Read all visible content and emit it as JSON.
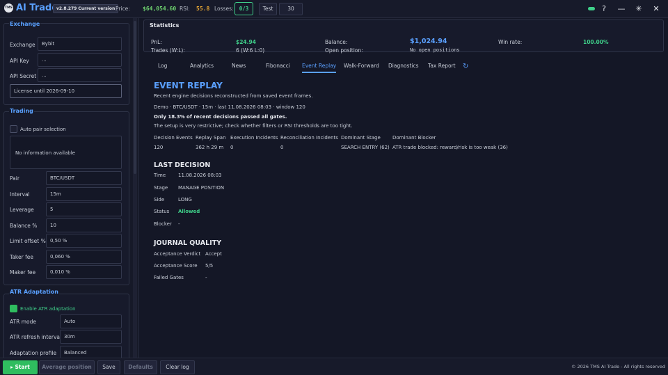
{
  "titlebar": {
    "logo_text": "TMS",
    "app_title": "AI Trade",
    "version": "v2.8.279 Current version",
    "price_label": "Price:",
    "price_value": "$64,054.60",
    "rsi_label": "RSI:",
    "rsi_value": "55.8",
    "losses_label": "Losses:",
    "losses_value": "0/3",
    "test_button": "Test",
    "test_value": "30",
    "help_icon": "?",
    "minimize_icon": "—",
    "maximize_icon": "✳",
    "close_icon": "✕"
  },
  "sidebar": {
    "exchange": {
      "title": "Exchange",
      "exchange_label": "Exchange",
      "exchange_value": "Bybit",
      "api_key_label": "API Key",
      "api_key_value": "...",
      "api_secret_label": "API Secret",
      "api_secret_value": "...",
      "license": "License until 2026-09-10"
    },
    "trading": {
      "title": "Trading",
      "auto_pair_label": "Auto pair selection",
      "info_text": "No information available",
      "fields": [
        {
          "label": "Pair",
          "value": "BTC/USDT"
        },
        {
          "label": "Interval",
          "value": "15m"
        },
        {
          "label": "Leverage",
          "value": "5"
        },
        {
          "label": "Balance %",
          "value": "10"
        },
        {
          "label": "Limit offset %",
          "value": "0,50 %"
        },
        {
          "label": "Taker fee",
          "value": "0,060 %"
        },
        {
          "label": "Maker fee",
          "value": "0,010 %"
        }
      ]
    },
    "atr": {
      "title": "ATR Adaptation",
      "enable_label": "Enable ATR adaptation",
      "fields": [
        {
          "label": "ATR mode",
          "value": "Auto"
        },
        {
          "label": "ATR refresh interval",
          "value": "30m"
        },
        {
          "label": "Adaptation profile",
          "value": "Balanced"
        }
      ]
    }
  },
  "statistics": {
    "title": "Statistics",
    "pnl_label": "PnL:",
    "pnl_value": "$24.94",
    "trades_label": "Trades (W:L):",
    "trades_value": "6 (W:6 L:0)",
    "balance_label": "Balance:",
    "balance_value": "$1,024.94",
    "open_position_label": "Open position:",
    "open_position_value": "No open positions",
    "winrate_label": "Win rate:",
    "winrate_value": "100.00%"
  },
  "tabs": [
    "Log",
    "Analytics",
    "News",
    "Fibonacci",
    "Event Replay",
    "Walk-Forward",
    "Diagnostics",
    "Tax Report"
  ],
  "active_tab": "Event Replay",
  "replay": {
    "heading": "EVENT REPLAY",
    "subtitle": "Recent engine decisions reconstructed from saved event frames.",
    "context": "Demo · BTC/USDT · 15m · last 11.08.2026 08:03 · window 120",
    "gates_line": "Only 18.3% of recent decisions passed all gates.",
    "hint": "The setup is very restrictive; check whether filters or RSI thresholds are too tight.",
    "table_headers": [
      "Decision Events",
      "Replay Span",
      "Execution Incidents",
      "Reconciliation Incidents",
      "Dominant Stage",
      "Dominant Blocker"
    ],
    "table_values": [
      "120",
      "362 h 29 m",
      "0",
      "0",
      "SEARCH ENTRY (62)",
      "ATR trade blocked: reward/risk is too weak (36)"
    ],
    "last_decision_heading": "LAST DECISION",
    "last_decision": [
      {
        "label": "Time",
        "value": "11.08.2026 08:03"
      },
      {
        "label": "Stage",
        "value": "MANAGE POSITION"
      },
      {
        "label": "Side",
        "value": "LONG"
      },
      {
        "label": "Status",
        "value": "Allowed"
      },
      {
        "label": "Blocker",
        "value": "-"
      }
    ],
    "journal_heading": "JOURNAL QUALITY",
    "journal": [
      {
        "label": "Acceptance Verdict",
        "value": "Accept"
      },
      {
        "label": "Acceptance Score",
        "value": "5/5"
      },
      {
        "label": "Failed Gates",
        "value": "-"
      }
    ]
  },
  "bottombar": {
    "start": "▸ Start",
    "average_position": "Average position",
    "save": "Save",
    "defaults": "Defaults",
    "clear_log": "Clear log",
    "copyright": "© 2026 TMS AI Trade - All rights reserved"
  },
  "colors": {
    "accent": "#5aa0ff",
    "positive": "#3fd08a",
    "warning": "#e8a735",
    "background": "#141726"
  }
}
